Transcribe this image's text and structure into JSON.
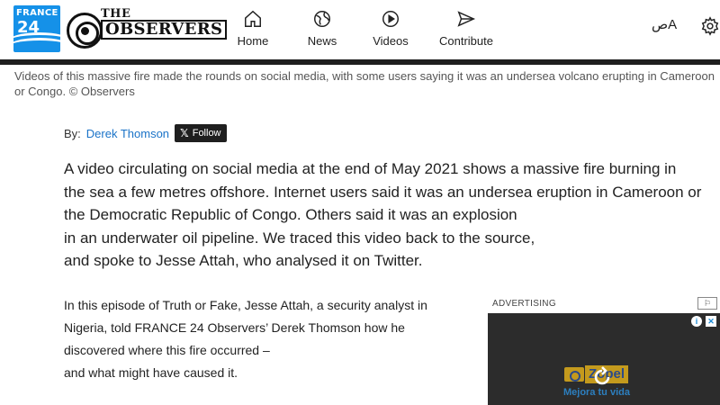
{
  "header": {
    "logo_france24_top": "FRANCE",
    "logo_france24_num": "24",
    "logo_observers_the": "THE",
    "logo_observers_name": "OBSERVERS",
    "nav": [
      {
        "label": "Home",
        "icon": "home-icon"
      },
      {
        "label": "News",
        "icon": "globe-icon"
      },
      {
        "label": "Videos",
        "icon": "play-circle-icon"
      },
      {
        "label": "Contribute",
        "icon": "send-icon"
      }
    ],
    "language_glyph": "ص‌A",
    "brand_color": "#1591e8"
  },
  "caption": "Videos of this massive fire made the rounds on social media, with some users saying it was an undersea volcano erupting in Cameroon or Congo. © Observers",
  "byline": {
    "prefix": "By:",
    "author": "Derek Thomson",
    "follow_label": "Follow",
    "follow_x": "𝕏"
  },
  "lead": {
    "lines": [
      "A video circulating on social media at the end of May 2021 shows a massive fire burning in",
      "the sea a few metres offshore. Internet users said it was an undersea eruption in Cameroon or",
      "the Democratic Republic of Congo. Others said it was an explosion",
      "in an underwater oil pipeline. We traced this video back to the source,",
      "and spoke to Jesse Attah, who analysed it on Twitter."
    ]
  },
  "body": {
    "lines": [
      "In this episode of Truth or Fake, Jesse Attah, a security analyst in",
      "Nigeria, told FRANCE 24 Observers’ Derek Thomson how he",
      "discovered where this fire occurred –",
      "and what might have caused it."
    ]
  },
  "ad": {
    "label": "ADVERTISING",
    "brand": "Zopel",
    "tagline": "Mejora tu vida"
  }
}
